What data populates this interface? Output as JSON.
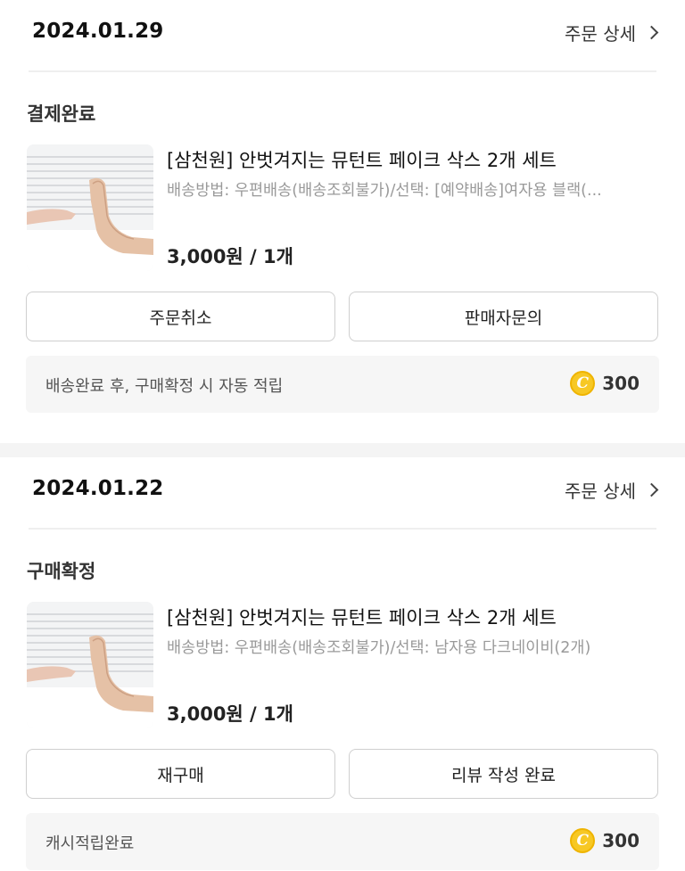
{
  "orders": [
    {
      "date": "2024.01.29",
      "detail_link": "주문 상세",
      "status": "결제완료",
      "product": {
        "title": "[삼천원] 안벗겨지는 뮤턴트 페이크 삭스 2개 세트",
        "option": "배송방법: 우편배송(배송조회불가)/선택: [예약배송]여자용 블랙(...",
        "price": "3,000원 / 1개"
      },
      "buttons": {
        "left": "주문취소",
        "right": "판매자문의"
      },
      "reward": {
        "text": "배송완료 후, 구매확정 시 자동 적립",
        "coin": "C",
        "amount": "300"
      }
    },
    {
      "date": "2024.01.22",
      "detail_link": "주문 상세",
      "status": "구매확정",
      "product": {
        "title": "[삼천원] 안벗겨지는 뮤턴트 페이크 삭스 2개 세트",
        "option": "배송방법: 우편배송(배송조회불가)/선택: 남자용 다크네이비(2개)",
        "price": "3,000원 / 1개"
      },
      "buttons": {
        "left": "재구매",
        "right": "리뷰 작성 완료"
      },
      "reward": {
        "text": "캐시적립완료",
        "coin": "C",
        "amount": "300"
      }
    }
  ],
  "colors": {
    "coin": "#f7c824",
    "section_bg": "#f6f6f6",
    "muted_text": "#9a9a9a"
  }
}
